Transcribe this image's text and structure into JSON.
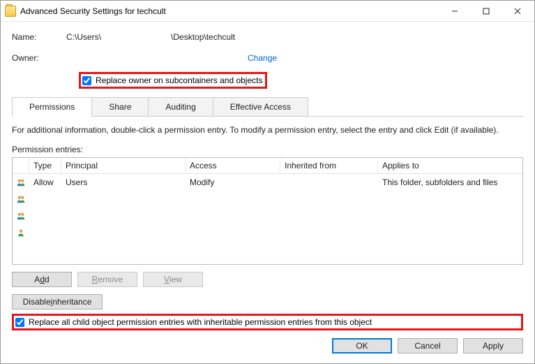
{
  "window": {
    "title": "Advanced Security Settings for techcult",
    "min_icon": "minimize",
    "max_icon": "maximize",
    "close_icon": "close"
  },
  "fields": {
    "name_label": "Name:",
    "name_value": "C:\\Users\\                              \\Desktop\\techcult",
    "owner_label": "Owner:",
    "owner_value": "",
    "change_link": "Change"
  },
  "replace_owner": {
    "checked": true,
    "label": "Replace owner on subcontainers and objects"
  },
  "tabs": [
    {
      "label": "Permissions",
      "active": true
    },
    {
      "label": "Share",
      "active": false
    },
    {
      "label": "Auditing",
      "active": false
    },
    {
      "label": "Effective Access",
      "active": false
    }
  ],
  "info": "For additional information, double-click a permission entry. To modify a permission entry, select the entry and click Edit (if available).",
  "perm_entries_label": "Permission entries:",
  "columns": {
    "type": "Type",
    "principal": "Principal",
    "access": "Access",
    "inherited": "Inherited from",
    "applies": "Applies to"
  },
  "rows": [
    {
      "icon": "users",
      "type": "Allow",
      "principal": "Users",
      "access": "Modify",
      "inherited": "",
      "applies": "This folder, subfolders and files"
    },
    {
      "icon": "users",
      "type": "",
      "principal": "",
      "access": "",
      "inherited": "",
      "applies": ""
    },
    {
      "icon": "users",
      "type": "",
      "principal": "",
      "access": "",
      "inherited": "",
      "applies": ""
    },
    {
      "icon": "user",
      "type": "",
      "principal": "",
      "access": "",
      "inherited": "",
      "applies": ""
    }
  ],
  "buttons": {
    "add": "Add",
    "remove": "Remove",
    "view": "View",
    "disable_inheritance": "Disable inheritance",
    "add_u": "d",
    "remove_u": "R",
    "view_u": "V",
    "disable_u": "i"
  },
  "replace_child": {
    "checked": true,
    "label": "Replace all child object permission entries with inheritable permission entries from this object"
  },
  "dialog": {
    "ok": "OK",
    "cancel": "Cancel",
    "apply": "Apply"
  }
}
